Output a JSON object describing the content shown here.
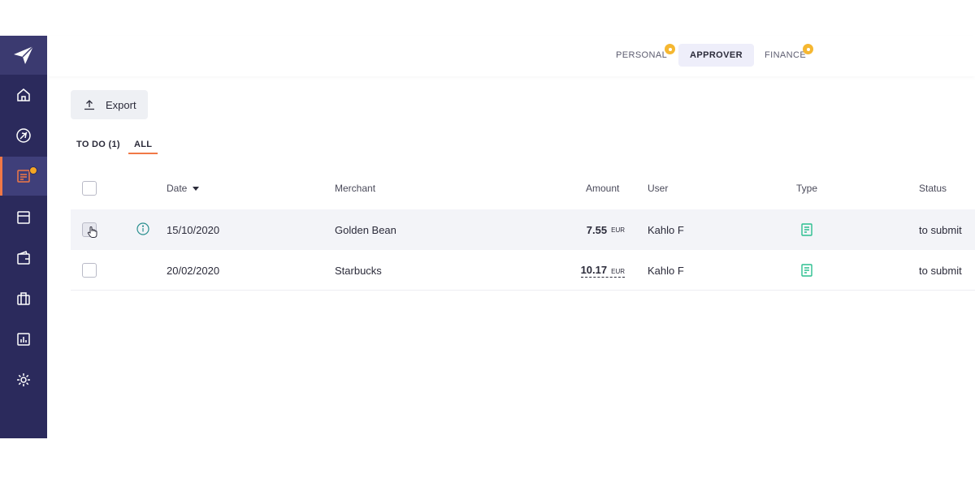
{
  "roles": {
    "personal": "PERSONAL",
    "approver": "APPROVER",
    "finance": "FINANCE"
  },
  "toolbar": {
    "export_label": "Export"
  },
  "filters": {
    "todo": "TO DO (1)",
    "all": "ALL"
  },
  "table": {
    "columns": {
      "date": "Date",
      "merchant": "Merchant",
      "amount": "Amount",
      "user": "User",
      "type": "Type",
      "status": "Status"
    },
    "rows": [
      {
        "date": "15/10/2020",
        "merchant": "Golden Bean",
        "amount": "7.55",
        "currency": "EUR",
        "user": "Kahlo F",
        "type_icon": "receipt-icon",
        "status": "to submit"
      },
      {
        "date": "20/02/2020",
        "merchant": "Starbucks",
        "amount": "10.17",
        "currency": "EUR",
        "user": "Kahlo F",
        "type_icon": "receipt-icon",
        "status": "to submit"
      }
    ]
  },
  "colors": {
    "sidebar": "#2b2a5c",
    "accent": "#f07846",
    "badge": "#f5b731",
    "type_icon": "#2bbf8f"
  }
}
